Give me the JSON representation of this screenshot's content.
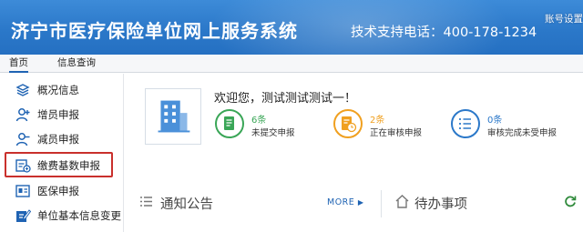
{
  "header": {
    "title": "济宁市医疗保险单位网上服务系统",
    "support_phone": "技术支持电话：400-178-1234",
    "account_link": "账号设置"
  },
  "tabs": [
    {
      "label": "首页",
      "active": true
    },
    {
      "label": "信息查询",
      "active": false
    }
  ],
  "sidebar": {
    "items": [
      {
        "label": "概况信息",
        "icon": "layers-icon"
      },
      {
        "label": "增员申报",
        "icon": "user-add-icon"
      },
      {
        "label": "减员申报",
        "icon": "user-remove-icon"
      },
      {
        "label": "缴费基数申报",
        "icon": "payment-base-icon",
        "highlighted": true
      },
      {
        "label": "医保申报",
        "icon": "id-card-icon"
      },
      {
        "label": "单位基本信息变更",
        "icon": "edit-icon"
      }
    ]
  },
  "main": {
    "welcome": "欢迎您，测试测试测试一！",
    "stats": [
      {
        "count": "6条",
        "label": "未提交申报",
        "color": "#3aa657",
        "icon": "document-icon"
      },
      {
        "count": "2条",
        "label": "正在审核申报",
        "color": "#f0a020",
        "icon": "document-clock-icon"
      },
      {
        "count": "0条",
        "label": "审核完成未受申报",
        "color": "#2b78c9",
        "icon": "checklist-icon"
      }
    ],
    "notice_title": "通知公告",
    "more_label": "MORE",
    "todo_title": "待办事项"
  },
  "colors": {
    "header_blue": "#2b78c9",
    "highlight_red": "#c9302c"
  }
}
